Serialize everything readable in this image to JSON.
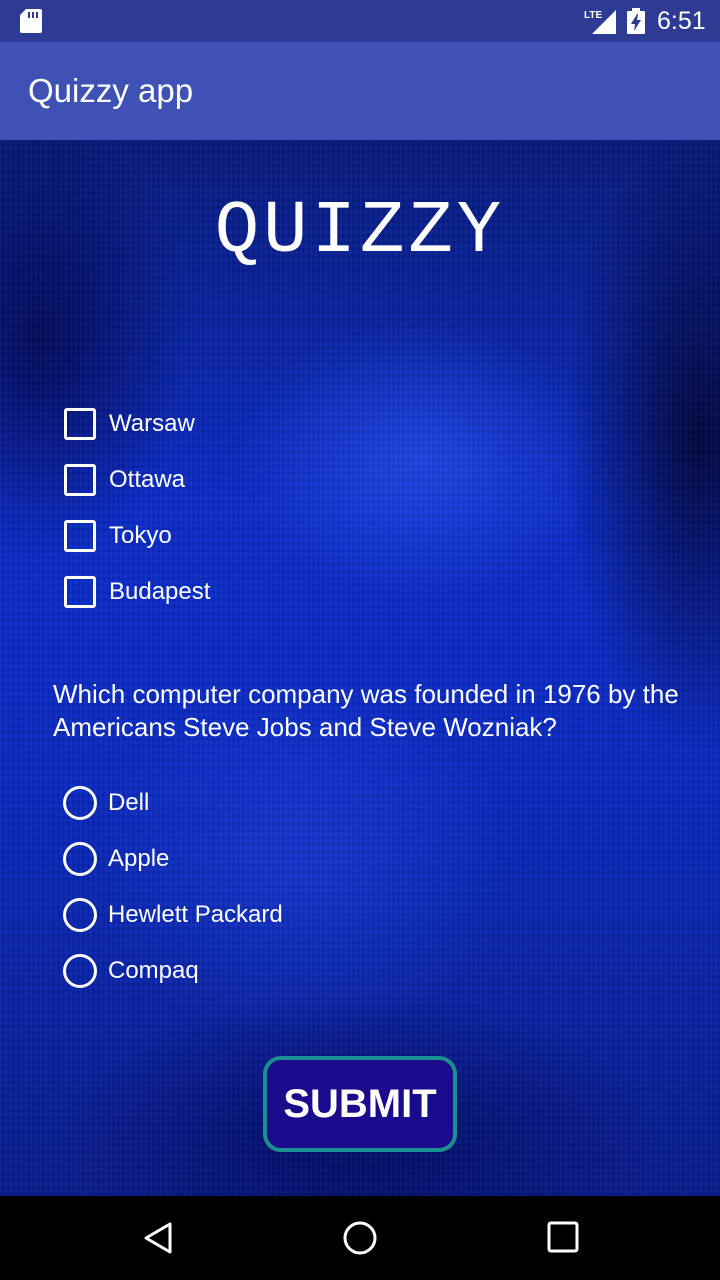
{
  "status_bar": {
    "network": "LTE",
    "time": "6:51",
    "icons": [
      "sd-card-icon",
      "lte-signal-icon",
      "battery-charging-icon"
    ]
  },
  "app_bar": {
    "title": "Quizzy app"
  },
  "main": {
    "heading": "QUIZZY",
    "checkbox_options": [
      {
        "label": "Warsaw",
        "checked": false
      },
      {
        "label": "Ottawa",
        "checked": false
      },
      {
        "label": "Tokyo",
        "checked": false
      },
      {
        "label": "Budapest",
        "checked": false
      }
    ],
    "question": "Which computer company was founded in 1976 by the Americans Steve Jobs and Steve Wozniak?",
    "radio_options": [
      {
        "label": "Dell",
        "selected": false
      },
      {
        "label": "Apple",
        "selected": false
      },
      {
        "label": "Hewlett Packard",
        "selected": false
      },
      {
        "label": "Compaq",
        "selected": false
      }
    ],
    "submit_label": "SUBMIT"
  },
  "nav_bar": {
    "icons": [
      "back-icon",
      "home-icon",
      "recent-apps-icon"
    ]
  },
  "colors": {
    "status_bar": "#2e3b94",
    "app_bar": "#3f51b5",
    "submit_bg": "#1a0a8c",
    "submit_border": "#1a8f8f"
  }
}
